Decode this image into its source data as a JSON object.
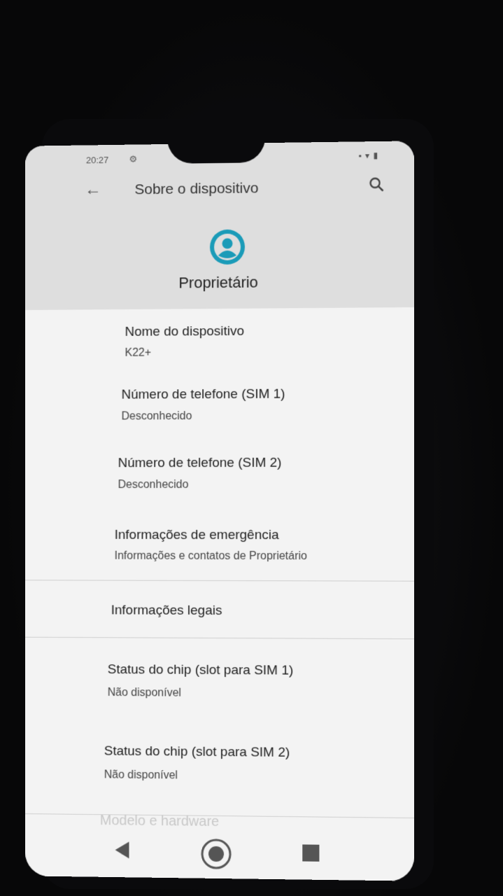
{
  "status_bar": {
    "time": "20:27",
    "icons_right": "▪ ▾ ▮"
  },
  "toolbar": {
    "back_icon": "arrow-left",
    "title": "Sobre o dispositivo",
    "search_icon": "magnifier"
  },
  "owner": {
    "avatar_icon": "account-circle",
    "label": "Proprietário",
    "accent_color": "#1a9bb8"
  },
  "items": [
    {
      "title": "Nome do dispositivo",
      "subtitle": "K22+"
    },
    {
      "title": "Número de telefone (SIM 1)",
      "subtitle": "Desconhecido"
    },
    {
      "title": "Número de telefone (SIM 2)",
      "subtitle": "Desconhecido"
    },
    {
      "title": "Informações de emergência",
      "subtitle": "Informações e contatos de Proprietário"
    },
    {
      "title": "Informações legais"
    },
    {
      "title": "Status do chip (slot para SIM 1)",
      "subtitle": "Não disponível"
    },
    {
      "title": "Status do chip (slot para SIM 2)",
      "subtitle": "Não disponível"
    },
    {
      "title": "Modelo e hardware"
    }
  ],
  "nav": {
    "back_icon": "triangle-back",
    "home_icon": "circle-home",
    "recents_icon": "square-recents"
  }
}
